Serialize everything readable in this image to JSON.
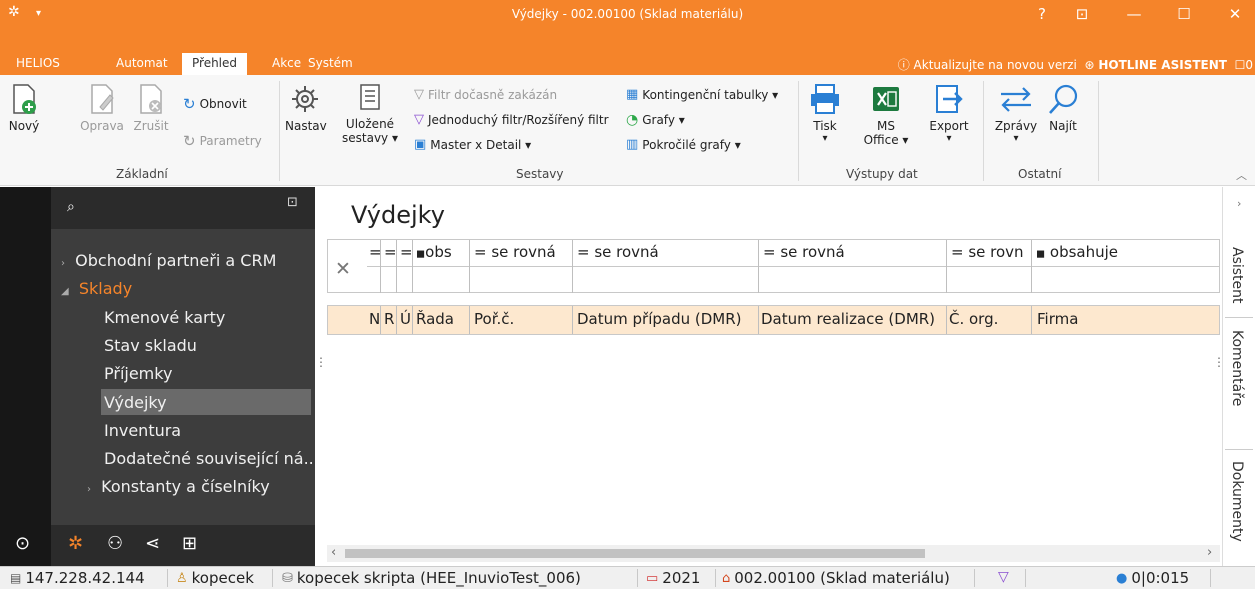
{
  "window": {
    "title": "Výdejky - 002.00100 (Sklad materiálu)",
    "help": "?",
    "controls": [
      "—",
      "☐",
      "✕"
    ]
  },
  "tabs": {
    "items": [
      "HELIOS",
      "Automat",
      "Přehled",
      "Akce",
      "Systém"
    ],
    "update_text": "ⓘ Aktualizujte na novou verzi",
    "hotline": "HOTLINE ASISTENT",
    "counter": "0"
  },
  "ribbon": {
    "zakladni": {
      "new": "Nový",
      "edit": "Oprava",
      "cancel": "Zrušit",
      "refresh": "Obnovit",
      "params": "Parametry",
      "label": "Základní"
    },
    "sestavy": {
      "setup": "Nastav",
      "saved1": "Uložené",
      "saved2": "sestavy ▾",
      "filter_disabled": "Filtr dočasně zakázán",
      "simple_filter": "Jednoduchý filtr/Rozšířený filtr",
      "master_detail": "Master x Detail ▾",
      "pivot": "Kontingenční tabulky ▾",
      "charts": "Grafy ▾",
      "adv_charts": "Pokročilé grafy ▾",
      "label": "Sestavy"
    },
    "vystupy": {
      "print": "Tisk",
      "office1": "MS",
      "office2": "Office ▾",
      "export": "Export",
      "label": "Výstupy dat"
    },
    "ostatni": {
      "messages": "Zprávy",
      "find": "Najít",
      "label": "Ostatní"
    }
  },
  "nav": {
    "items": [
      {
        "label": "Obchodní partneři a CRM"
      },
      {
        "label": "Sklady"
      },
      {
        "label": "Kmenové karty"
      },
      {
        "label": "Stav skladu"
      },
      {
        "label": "Příjemky"
      },
      {
        "label": "Výdejky"
      },
      {
        "label": "Inventura"
      },
      {
        "label": "Dodatečné související ná..."
      },
      {
        "label": "Konstanty a číselníky"
      }
    ]
  },
  "main": {
    "title": "Výdejky",
    "filter_ops": [
      "=",
      "=",
      "=",
      "obs",
      "= se rovná",
      "= se rovná",
      "= se rovná",
      "= se rovn",
      "obsahuje"
    ],
    "columns": [
      "N",
      "R",
      "Ú",
      "Řada",
      "Poř.č.",
      "Datum případu (DMR)",
      "Datum realizace (DMR)",
      "Č. org.",
      "Firma"
    ]
  },
  "right_tabs": [
    "Asistent",
    "Komentáře",
    "Dokumenty"
  ],
  "status": {
    "ip": "147.228.42.144",
    "user": "kopecek",
    "db": "kopecek skripta (HEE_InuvioTest_006)",
    "year": "2021",
    "warehouse": "002.00100 (Sklad materiálu)",
    "counter": "0|0:015"
  },
  "colors": {
    "accent": "#f5842a",
    "nav_bg": "#3d3d3d",
    "header_row": "#fde8cf"
  }
}
